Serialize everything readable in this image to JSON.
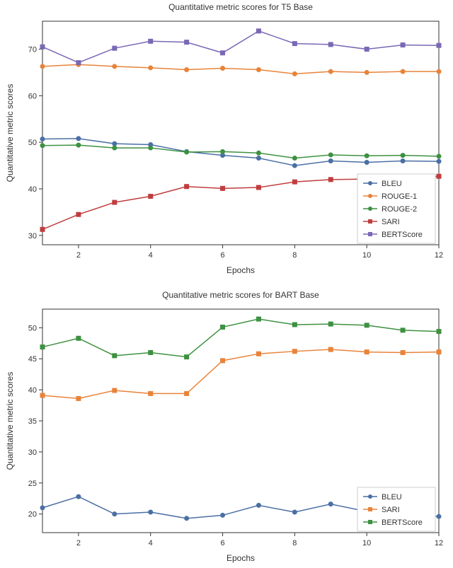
{
  "chart_data": [
    {
      "type": "line",
      "title": "Quantitative metric scores for T5 Base",
      "xlabel": "Epochs",
      "ylabel": "Quantitative metric scores",
      "xlim": [
        1,
        12
      ],
      "ylim": [
        28,
        76
      ],
      "xticks": [
        2,
        4,
        6,
        8,
        10,
        12
      ],
      "yticks": [
        30,
        40,
        50,
        60,
        70
      ],
      "x": [
        1,
        2,
        3,
        4,
        5,
        6,
        7,
        8,
        9,
        10,
        11,
        12
      ],
      "series": [
        {
          "name": "BLEU",
          "color": "#4a6fa5",
          "marker": "circle",
          "values": [
            50.7,
            50.8,
            49.7,
            49.5,
            48.0,
            47.2,
            46.6,
            45.0,
            46.0,
            45.7,
            46.0,
            45.9
          ]
        },
        {
          "name": "ROUGE-1",
          "color": "#e8833a",
          "marker": "circle",
          "values": [
            66.3,
            66.7,
            66.3,
            66.0,
            65.6,
            65.9,
            65.6,
            64.7,
            65.2,
            65.0,
            65.2,
            65.2
          ]
        },
        {
          "name": "ROUGE-2",
          "color": "#3d9140",
          "marker": "circle",
          "values": [
            49.3,
            49.4,
            48.8,
            48.8,
            47.9,
            48.0,
            47.7,
            46.6,
            47.3,
            47.1,
            47.2,
            47.0
          ]
        },
        {
          "name": "SARI",
          "color": "#c03d3e",
          "marker": "square",
          "values": [
            31.3,
            34.5,
            37.1,
            38.4,
            40.5,
            40.1,
            40.3,
            41.5,
            42.0,
            42.1,
            42.2,
            42.7
          ]
        },
        {
          "name": "BERTScore",
          "color": "#7a68b5",
          "marker": "square",
          "values": [
            70.5,
            67.1,
            70.2,
            71.7,
            71.5,
            69.2,
            73.9,
            71.2,
            71.0,
            70.0,
            70.9,
            70.8
          ]
        }
      ],
      "legend_pos": "right"
    },
    {
      "type": "line",
      "title": "Quantitative metric scores for BART Base",
      "xlabel": "Epochs",
      "ylabel": "Quantitative metric scores",
      "xlim": [
        1,
        12
      ],
      "ylim": [
        17,
        53
      ],
      "xticks": [
        2,
        4,
        6,
        8,
        10,
        12
      ],
      "yticks": [
        20,
        25,
        30,
        35,
        40,
        45,
        50
      ],
      "x": [
        1,
        2,
        3,
        4,
        5,
        6,
        7,
        8,
        9,
        10,
        11,
        12
      ],
      "series": [
        {
          "name": "BLEU",
          "color": "#4a6fa5",
          "marker": "circle",
          "values": [
            21.0,
            22.8,
            20.0,
            20.3,
            19.3,
            19.8,
            21.4,
            20.3,
            21.6,
            20.4,
            19.8,
            19.6
          ]
        },
        {
          "name": "SARI",
          "color": "#e8833a",
          "marker": "square",
          "values": [
            39.1,
            38.6,
            39.9,
            39.4,
            39.4,
            44.7,
            45.8,
            46.2,
            46.5,
            46.1,
            46.0,
            46.1
          ]
        },
        {
          "name": "BERTScore",
          "color": "#3d9140",
          "marker": "square",
          "values": [
            46.9,
            48.3,
            45.5,
            46.0,
            45.3,
            50.1,
            51.4,
            50.5,
            50.6,
            50.4,
            49.6,
            49.4
          ]
        }
      ],
      "legend_pos": "right"
    }
  ]
}
